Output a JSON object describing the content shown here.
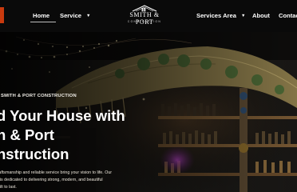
{
  "nav": {
    "links": [
      {
        "label": "Home"
      },
      {
        "label": "Service"
      },
      {
        "label": "Services Area"
      },
      {
        "label": "About"
      },
      {
        "label": "Contact"
      }
    ]
  },
  "logo": {
    "name": "SMITH & PORT",
    "tagline": "CONSTRUCTION"
  },
  "hero": {
    "eyebrow": "SMITH & PORT CONSTRUCTION",
    "headline_lines": [
      "d Your House with",
      "h & Port",
      "nstruction"
    ],
    "copy_lines": [
      "craftsmanship and reliable service bring your vision to life. Our",
      "m is dedicated to delivering strong, modern, and beautiful",
      "built to last."
    ]
  },
  "colors": {
    "accent": "#c93a0e",
    "nav_bg": "#0a0a0a"
  }
}
